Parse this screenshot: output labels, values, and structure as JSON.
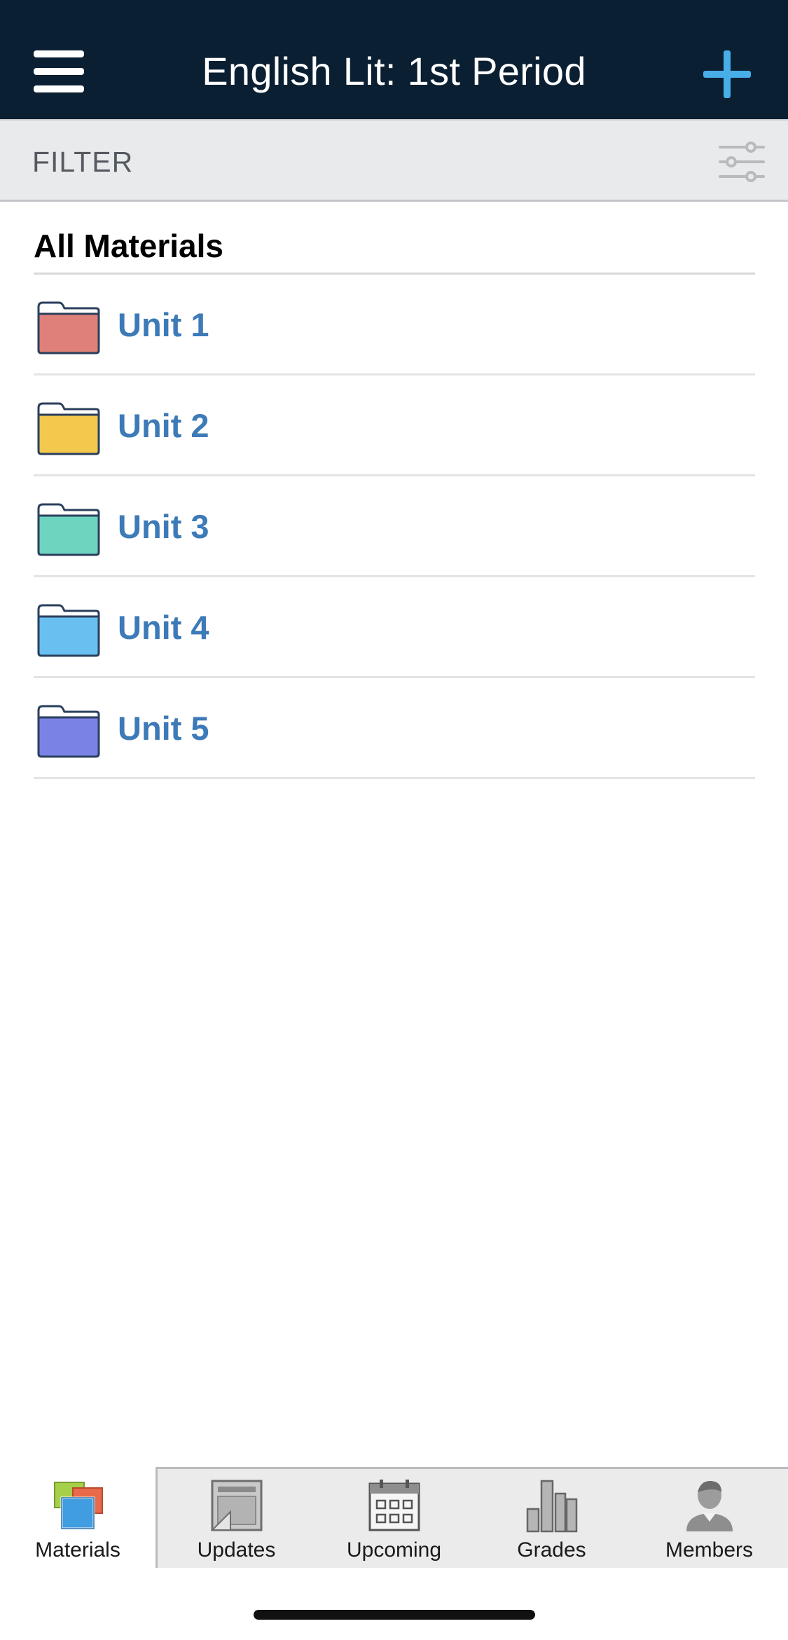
{
  "header": {
    "title": "English Lit: 1st Period",
    "menu_icon": "hamburger-menu-icon",
    "add_icon": "plus-icon",
    "background_color": "#0b1f33",
    "accent_color": "#47aee8"
  },
  "filter": {
    "label": "FILTER",
    "icon": "sliders-icon"
  },
  "materials": {
    "section_title": "All Materials",
    "items": [
      {
        "label": "Unit 1",
        "folder_color": "#e0807a"
      },
      {
        "label": "Unit 2",
        "folder_color": "#f2c94c"
      },
      {
        "label": "Unit 3",
        "folder_color": "#6dd4c0"
      },
      {
        "label": "Unit 4",
        "folder_color": "#68bff0"
      },
      {
        "label": "Unit 5",
        "folder_color": "#7b82e6"
      }
    ],
    "link_color": "#3d7ab8"
  },
  "tabbar": {
    "tabs": [
      {
        "label": "Materials",
        "icon": "materials-icon",
        "active": true
      },
      {
        "label": "Updates",
        "icon": "updates-icon",
        "active": false
      },
      {
        "label": "Upcoming",
        "icon": "calendar-icon",
        "active": false
      },
      {
        "label": "Grades",
        "icon": "bar-chart-icon",
        "active": false
      },
      {
        "label": "Members",
        "icon": "person-icon",
        "active": false
      }
    ]
  }
}
